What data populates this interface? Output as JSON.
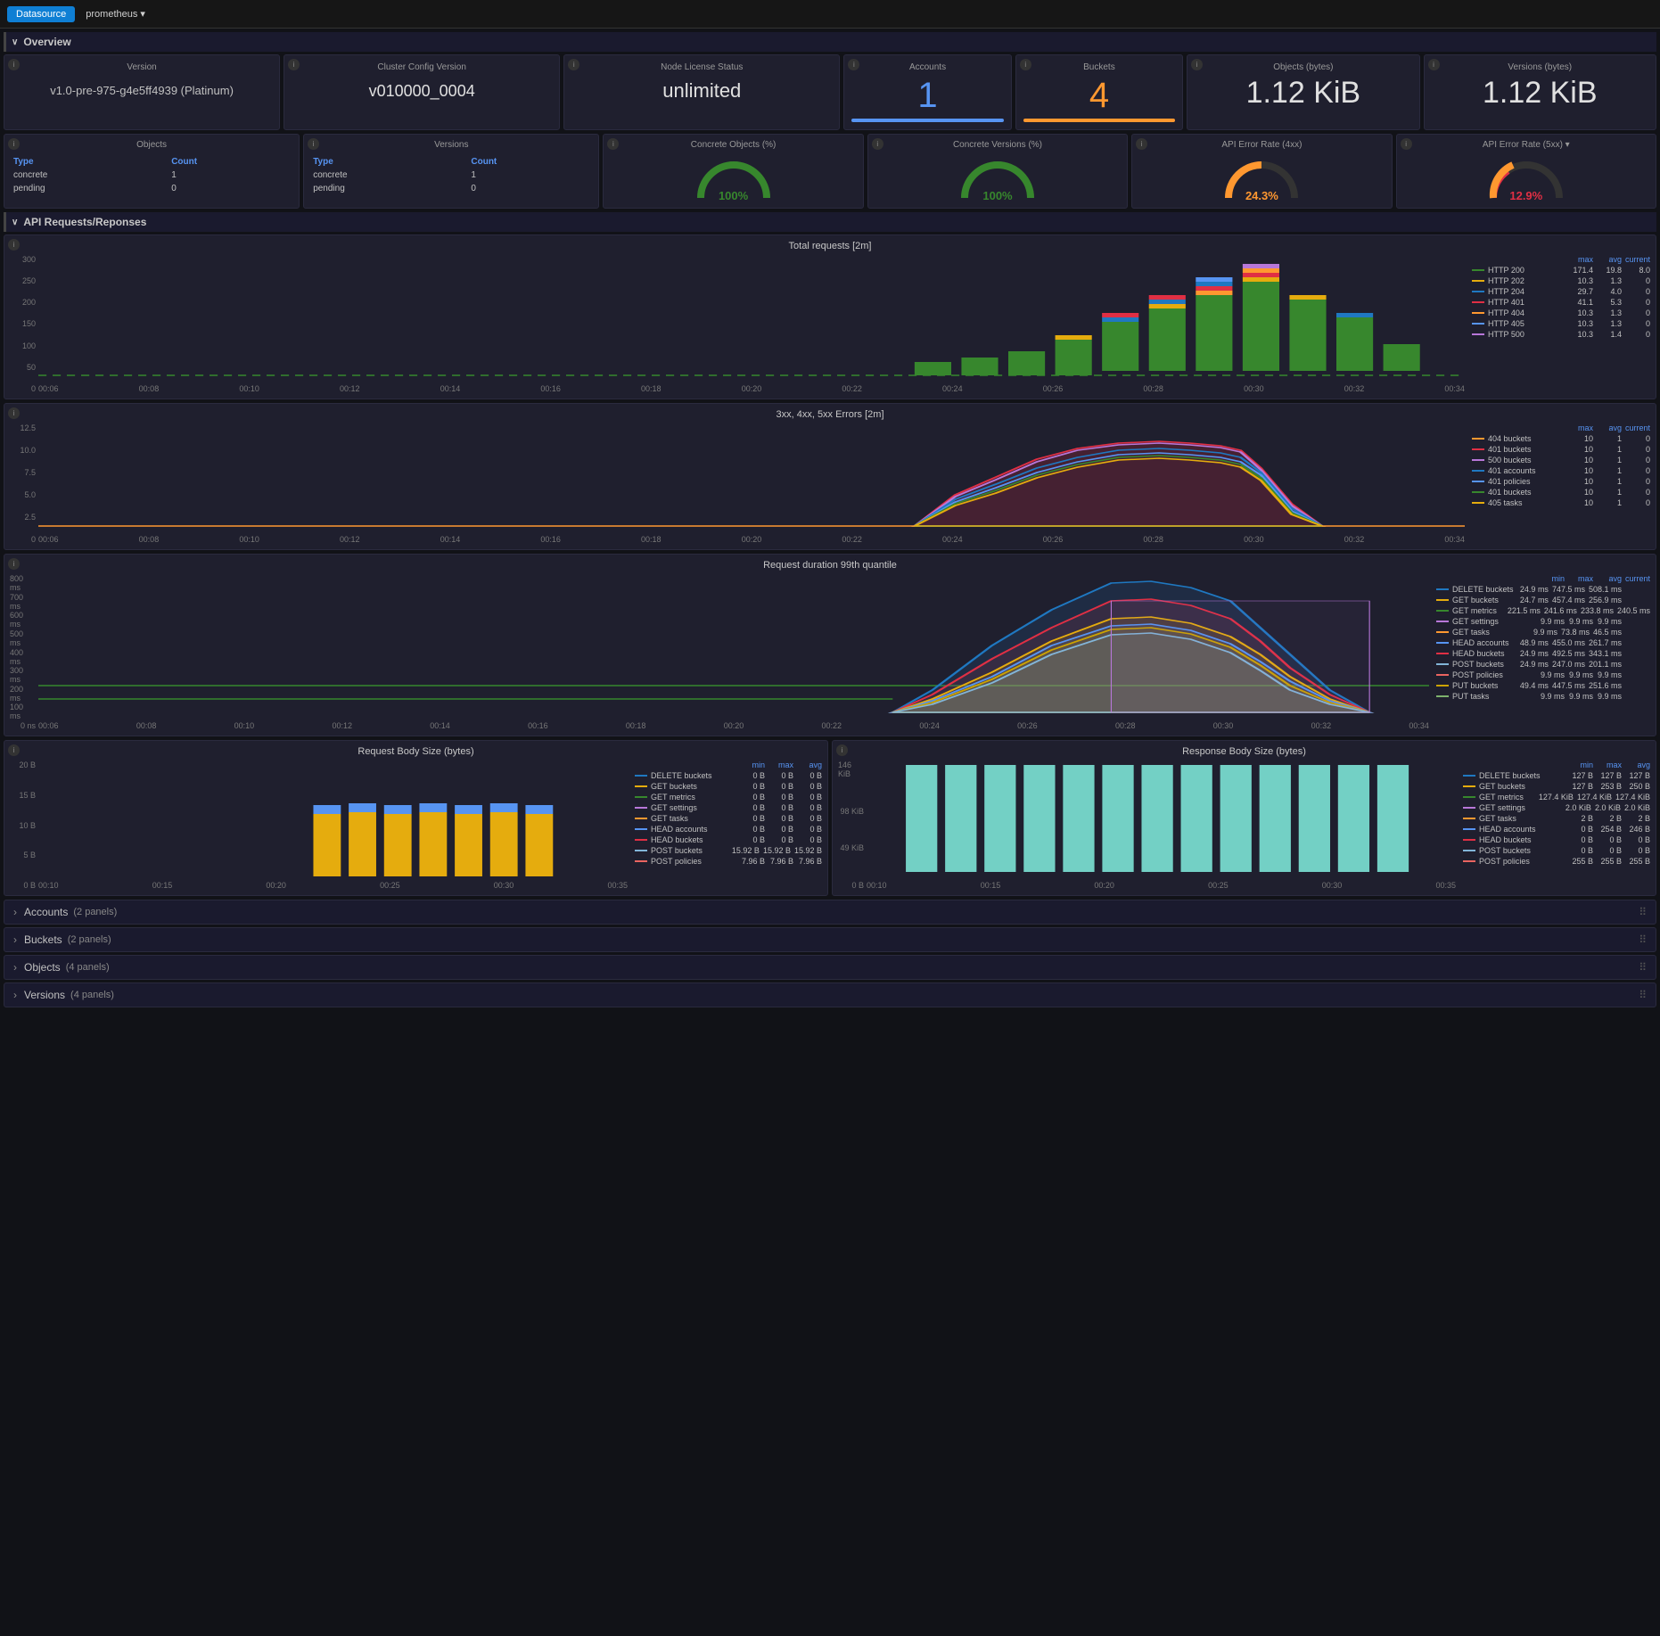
{
  "topbar": {
    "tab_datasource": "Datasource",
    "datasource_name": "prometheus",
    "chevron": "▾"
  },
  "overview_section": {
    "label": "Overview",
    "chevron": "∨"
  },
  "stat_panels": {
    "version": {
      "title": "Version",
      "value": "v1.0-pre-975-g4e5ff4939 (Platinum)"
    },
    "cluster_config": {
      "title": "Cluster Config Version",
      "value": "v010000_0004"
    },
    "license_status": {
      "title": "Node License Status",
      "value": "unlimited"
    },
    "accounts": {
      "title": "Accounts",
      "value": "1"
    },
    "buckets": {
      "title": "Buckets",
      "value": "4"
    },
    "objects_bytes": {
      "title": "Objects (bytes)",
      "value": "1.12 KiB"
    },
    "versions_bytes": {
      "title": "Versions (bytes)",
      "value": "1.12 KiB"
    }
  },
  "table_panels": {
    "objects": {
      "title": "Objects",
      "col1": "Type",
      "col2": "Count",
      "rows": [
        {
          "type": "concrete",
          "count": "1"
        },
        {
          "type": "pending",
          "count": "0"
        }
      ]
    },
    "versions": {
      "title": "Versions",
      "col1": "Type",
      "col2": "Count",
      "rows": [
        {
          "type": "concrete",
          "count": "1"
        },
        {
          "type": "pending",
          "count": "0"
        }
      ]
    }
  },
  "gauge_panels": {
    "concrete_objects": {
      "title": "Concrete Objects (%)",
      "value": "100%",
      "color": "#37872d"
    },
    "concrete_versions": {
      "title": "Concrete Versions (%)",
      "value": "100%",
      "color": "#37872d"
    },
    "api_error_4xx": {
      "title": "API Error Rate (4xx)",
      "value": "24.3%",
      "color": "#ff9830"
    },
    "api_error_5xx": {
      "title": "API Error Rate (5xx) ▾",
      "value": "12.9%",
      "color": "#e02f44"
    }
  },
  "api_section": {
    "label": "API Requests/Reponses",
    "chevron": "∨"
  },
  "total_requests_chart": {
    "title": "Total requests [2m]",
    "y_labels": [
      "300",
      "250",
      "200",
      "150",
      "100",
      "50",
      "0"
    ],
    "x_labels": [
      "00:06",
      "00:08",
      "00:10",
      "00:12",
      "00:14",
      "00:16",
      "00:18",
      "00:20",
      "00:22",
      "00:24",
      "00:26",
      "00:28",
      "00:30",
      "00:32",
      "00:34"
    ],
    "legend": [
      {
        "label": "HTTP 200",
        "color": "#37872d",
        "max": "171.4",
        "avg": "19.8",
        "current": "8.0"
      },
      {
        "label": "HTTP 202",
        "color": "#e5ac0e",
        "max": "10.3",
        "avg": "1.3",
        "current": "0"
      },
      {
        "label": "HTTP 204",
        "color": "#1f78c1",
        "max": "29.7",
        "avg": "4.0",
        "current": "0"
      },
      {
        "label": "HTTP 401",
        "color": "#e02f44",
        "max": "41.1",
        "avg": "5.3",
        "current": "0"
      },
      {
        "label": "HTTP 404",
        "color": "#ff9830",
        "max": "10.3",
        "avg": "1.3",
        "current": "0"
      },
      {
        "label": "HTTP 405",
        "color": "#5794f2",
        "max": "10.3",
        "avg": "1.3",
        "current": "0"
      },
      {
        "label": "HTTP 500",
        "color": "#b877d9",
        "max": "10.3",
        "avg": "1.4",
        "current": "0"
      }
    ],
    "legend_headers": [
      "max",
      "avg",
      "current"
    ]
  },
  "errors_chart": {
    "title": "3xx, 4xx, 5xx Errors [2m]",
    "y_labels": [
      "12.5",
      "10.0",
      "7.5",
      "5.0",
      "2.5",
      "0"
    ],
    "x_labels": [
      "00:06",
      "00:08",
      "00:10",
      "00:12",
      "00:14",
      "00:16",
      "00:18",
      "00:20",
      "00:22",
      "00:24",
      "00:26",
      "00:28",
      "00:30",
      "00:32",
      "00:34"
    ],
    "legend": [
      {
        "label": "404 buckets",
        "color": "#ff9830",
        "max": "10",
        "avg": "1",
        "current": "0"
      },
      {
        "label": "401 buckets",
        "color": "#e02f44",
        "max": "10",
        "avg": "1",
        "current": "0"
      },
      {
        "label": "500 buckets",
        "color": "#b877d9",
        "max": "10",
        "avg": "1",
        "current": "0"
      },
      {
        "label": "401 accounts",
        "color": "#1f78c1",
        "max": "10",
        "avg": "1",
        "current": "0"
      },
      {
        "label": "401 policies",
        "color": "#5794f2",
        "max": "10",
        "avg": "1",
        "current": "0"
      },
      {
        "label": "401 buckets",
        "color": "#37872d",
        "max": "10",
        "avg": "1",
        "current": "0"
      },
      {
        "label": "405 tasks",
        "color": "#e5ac0e",
        "max": "10",
        "avg": "1",
        "current": "0"
      }
    ]
  },
  "request_duration_chart": {
    "title": "Request duration 99th quantile",
    "y_labels": [
      "800 ms",
      "700 ms",
      "600 ms",
      "500 ms",
      "400 ms",
      "300 ms",
      "200 ms",
      "100 ms",
      "0 ns"
    ],
    "x_labels": [
      "00:06",
      "00:08",
      "00:10",
      "00:12",
      "00:14",
      "00:16",
      "00:18",
      "00:20",
      "00:22",
      "00:24",
      "00:26",
      "00:28",
      "00:30",
      "00:32",
      "00:34"
    ],
    "legend_headers": [
      "min",
      "max",
      "avg",
      "current"
    ],
    "legend": [
      {
        "label": "DELETE buckets",
        "color": "#1f78c1",
        "min": "24.9 ms",
        "max": "747.5 ms",
        "avg": "508.1 ms",
        "current": ""
      },
      {
        "label": "GET buckets",
        "color": "#e5ac0e",
        "min": "24.7 ms",
        "max": "457.4 ms",
        "avg": "256.9 ms",
        "current": ""
      },
      {
        "label": "GET metrics",
        "color": "#37872d",
        "min": "221.5 ms",
        "max": "241.6 ms",
        "avg": "233.8 ms",
        "current": "240.5 ms"
      },
      {
        "label": "GET settings",
        "color": "#b877d9",
        "min": "9.9 ms",
        "max": "9.9 ms",
        "avg": "9.9 ms",
        "current": ""
      },
      {
        "label": "GET tasks",
        "color": "#ff9830",
        "min": "9.9 ms",
        "max": "73.8 ms",
        "avg": "46.5 ms",
        "current": ""
      },
      {
        "label": "HEAD accounts",
        "color": "#5794f2",
        "min": "48.9 ms",
        "max": "455.0 ms",
        "avg": "261.7 ms",
        "current": ""
      },
      {
        "label": "HEAD buckets",
        "color": "#e02f44",
        "min": "24.9 ms",
        "max": "492.5 ms",
        "avg": "343.1 ms",
        "current": ""
      },
      {
        "label": "POST buckets",
        "color": "#82b5d8",
        "min": "24.9 ms",
        "max": "247.0 ms",
        "avg": "201.1 ms",
        "current": ""
      },
      {
        "label": "POST policies",
        "color": "#ea6460",
        "min": "9.9 ms",
        "max": "9.9 ms",
        "avg": "9.9 ms",
        "current": ""
      },
      {
        "label": "PUT buckets",
        "color": "#cca300",
        "min": "49.4 ms",
        "max": "447.5 ms",
        "avg": "251.6 ms",
        "current": ""
      },
      {
        "label": "PUT tasks",
        "color": "#7eb26d",
        "min": "9.9 ms",
        "max": "9.9 ms",
        "avg": "9.9 ms",
        "current": ""
      }
    ]
  },
  "request_body_chart": {
    "title": "Request Body Size (bytes)",
    "y_labels": [
      "20 B",
      "15 B",
      "10 B",
      "5 B",
      "0 B"
    ],
    "x_labels": [
      "00:10",
      "00:15",
      "00:20",
      "00:25",
      "00:30",
      "00:35"
    ],
    "legend_headers": [
      "min",
      "max",
      "avg"
    ],
    "legend": [
      {
        "label": "DELETE buckets",
        "color": "#1f78c1",
        "min": "0 B",
        "max": "0 B",
        "avg": "0 B"
      },
      {
        "label": "GET buckets",
        "color": "#e5ac0e",
        "min": "0 B",
        "max": "0 B",
        "avg": "0 B"
      },
      {
        "label": "GET metrics",
        "color": "#37872d",
        "min": "0 B",
        "max": "0 B",
        "avg": "0 B"
      },
      {
        "label": "GET settings",
        "color": "#b877d9",
        "min": "0 B",
        "max": "0 B",
        "avg": "0 B"
      },
      {
        "label": "GET tasks",
        "color": "#ff9830",
        "min": "0 B",
        "max": "0 B",
        "avg": "0 B"
      },
      {
        "label": "HEAD accounts",
        "color": "#5794f2",
        "min": "0 B",
        "max": "0 B",
        "avg": "0 B"
      },
      {
        "label": "HEAD buckets",
        "color": "#e02f44",
        "min": "0 B",
        "max": "0 B",
        "avg": "0 B"
      },
      {
        "label": "POST buckets",
        "color": "#82b5d8",
        "min": "15.92 B",
        "max": "15.92 B",
        "avg": "15.92 B"
      },
      {
        "label": "POST policies",
        "color": "#ea6460",
        "min": "7.96 B",
        "max": "7.96 B",
        "avg": "7.96 B"
      }
    ]
  },
  "response_body_chart": {
    "title": "Response Body Size (bytes)",
    "y_labels": [
      "146 KiB",
      "98 KiB",
      "49 KiB",
      "0 B"
    ],
    "x_labels": [
      "00:10",
      "00:15",
      "00:20",
      "00:25",
      "00:30",
      "00:35"
    ],
    "legend_headers": [
      "min",
      "max",
      "avg"
    ],
    "legend": [
      {
        "label": "DELETE buckets",
        "color": "#1f78c1",
        "min": "127 B",
        "max": "127 B",
        "avg": "127 B"
      },
      {
        "label": "GET buckets",
        "color": "#e5ac0e",
        "min": "127 B",
        "max": "253 B",
        "avg": "250 B"
      },
      {
        "label": "GET metrics",
        "color": "#37872d",
        "min": "127.4 KiB",
        "max": "127.4 KiB",
        "avg": "127.4 KiB"
      },
      {
        "label": "GET settings",
        "color": "#b877d9",
        "min": "2.0 KiB",
        "max": "2.0 KiB",
        "avg": "2.0 KiB"
      },
      {
        "label": "GET tasks",
        "color": "#ff9830",
        "min": "2 B",
        "max": "2 B",
        "avg": "2 B"
      },
      {
        "label": "HEAD accounts",
        "color": "#5794f2",
        "min": "0 B",
        "max": "254 B",
        "avg": "246 B"
      },
      {
        "label": "HEAD buckets",
        "color": "#e02f44",
        "min": "0 B",
        "max": "0 B",
        "avg": "0 B"
      },
      {
        "label": "POST buckets",
        "color": "#82b5d8",
        "min": "0 B",
        "max": "0 B",
        "avg": "0 B"
      },
      {
        "label": "POST policies",
        "color": "#ea6460",
        "min": "255 B",
        "max": "255 B",
        "avg": "255 B"
      }
    ]
  },
  "collapsible_sections": [
    {
      "label": "Accounts",
      "count": "(2 panels)"
    },
    {
      "label": "Buckets",
      "count": "(2 panels)"
    },
    {
      "label": "Objects",
      "count": "(4 panels)"
    },
    {
      "label": "Versions",
      "count": "(4 panels)"
    }
  ]
}
